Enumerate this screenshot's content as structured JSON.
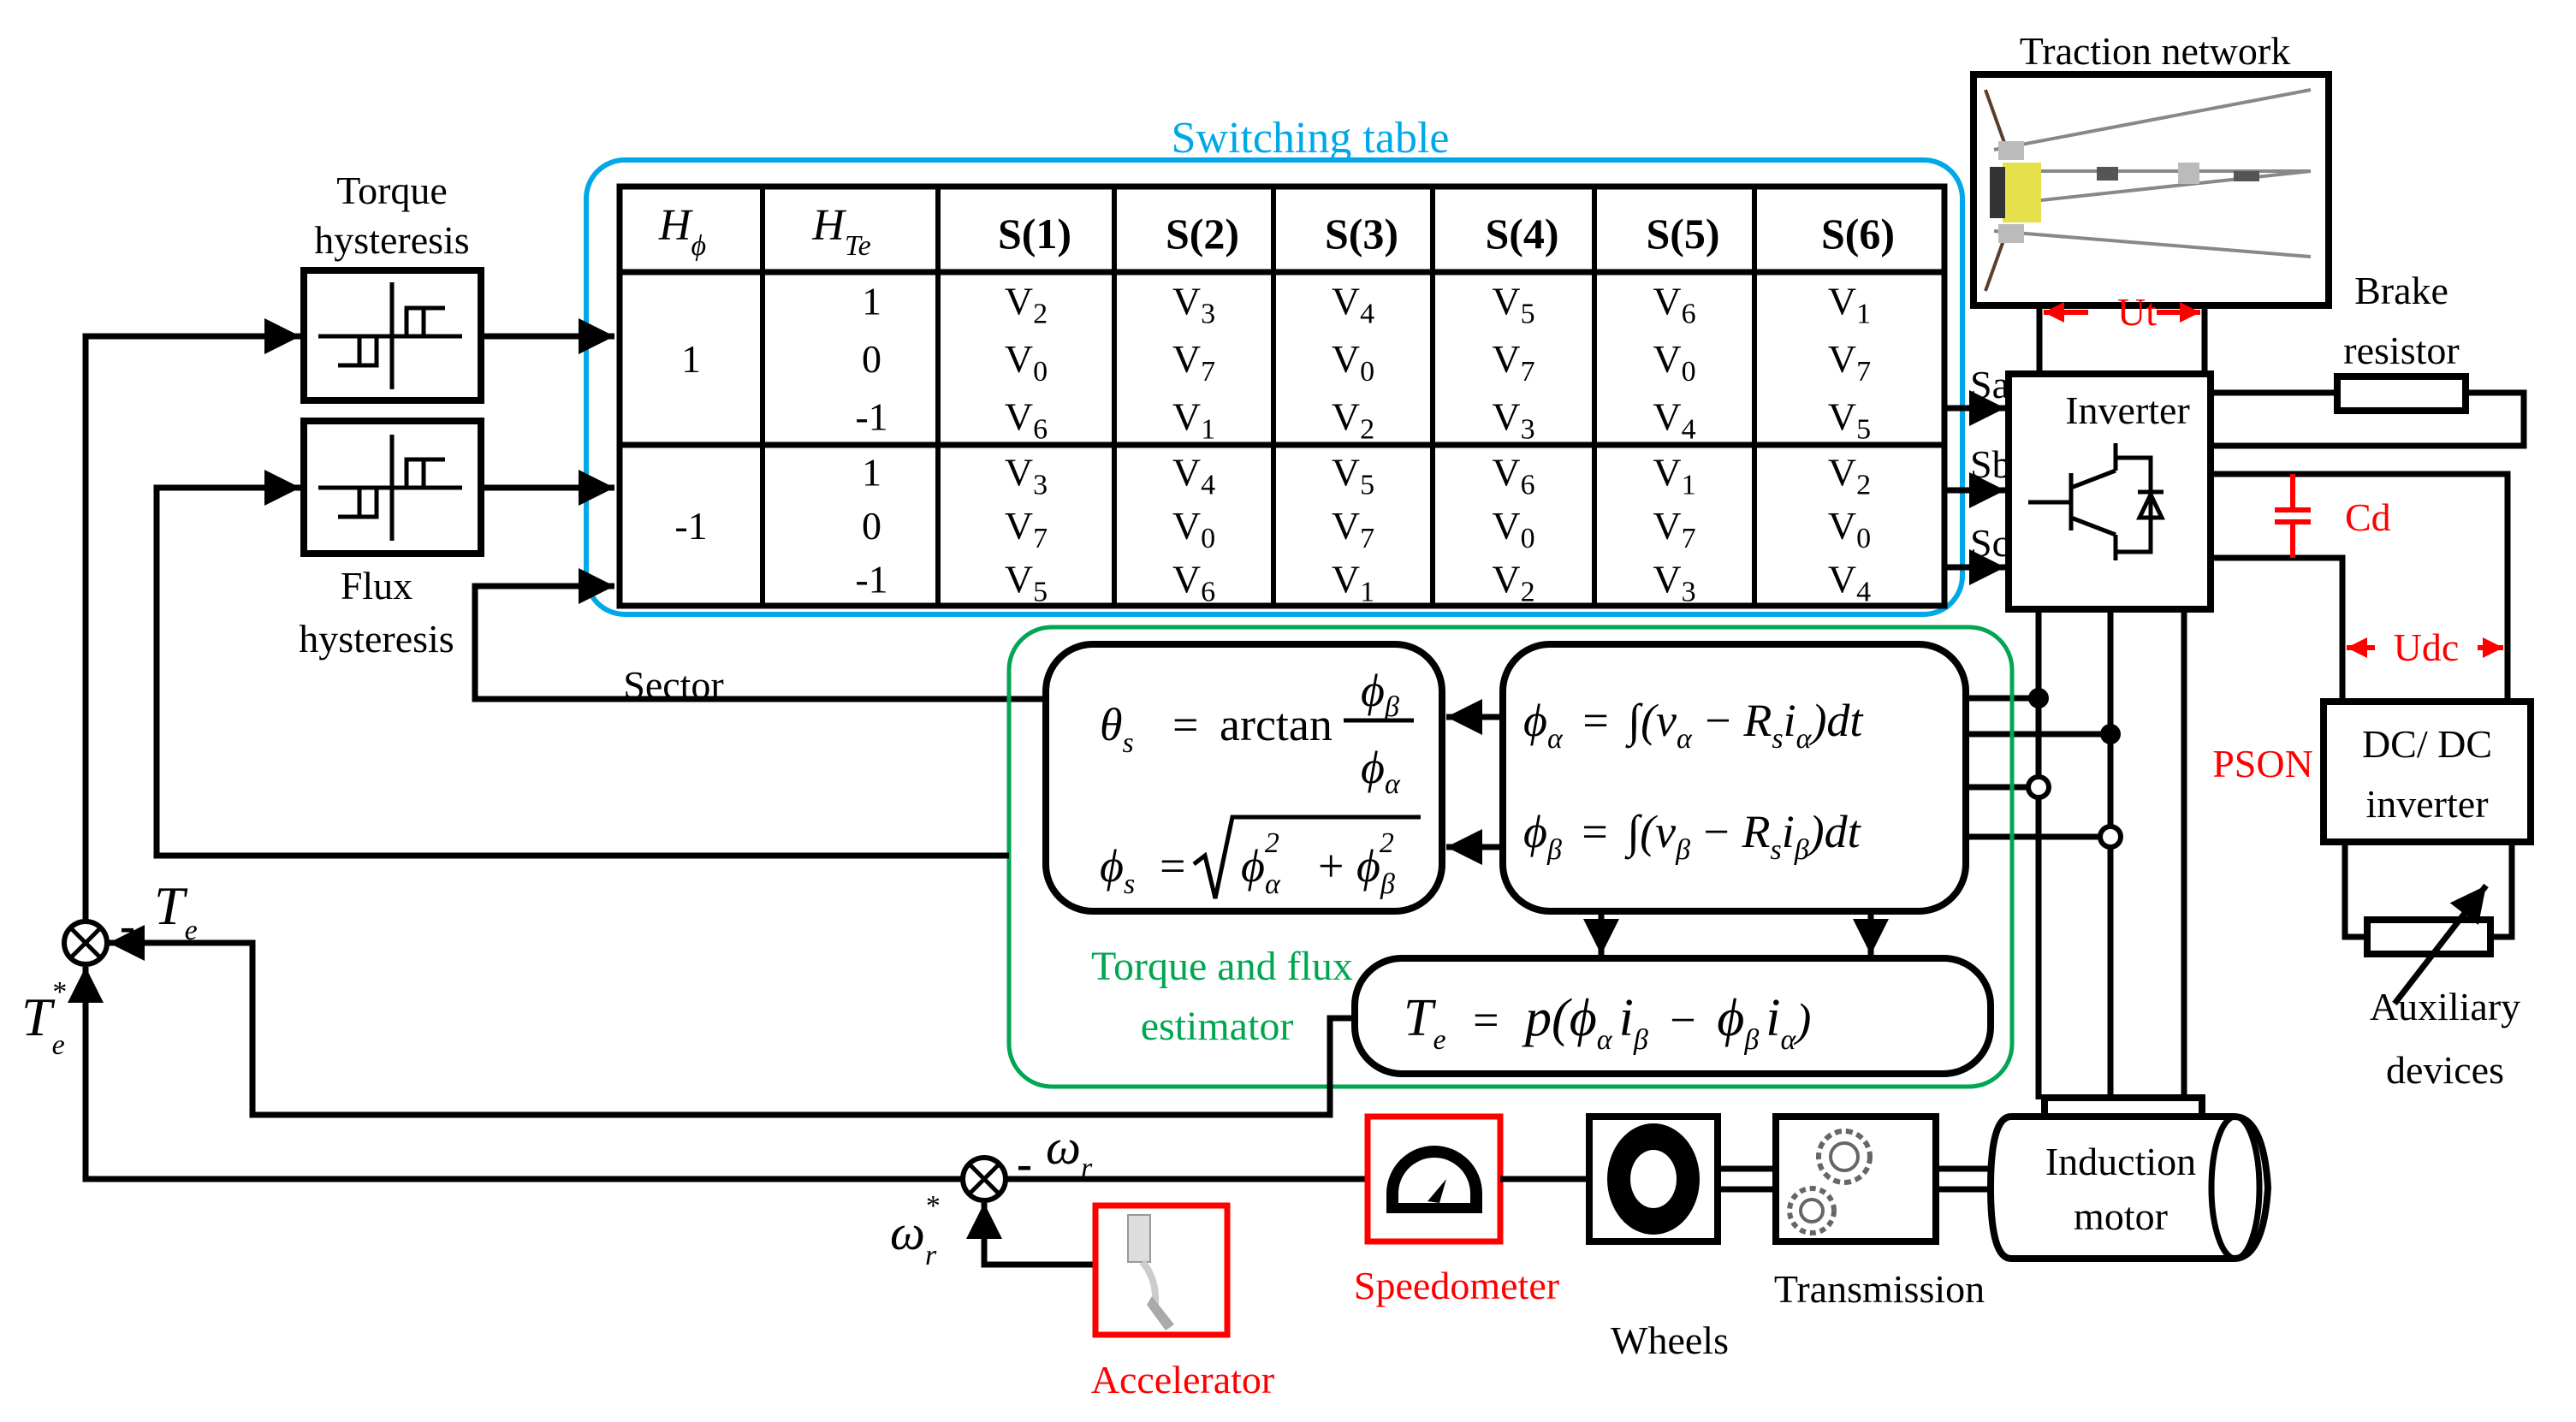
{
  "colors": {
    "switching_table_border": "#00a8e8",
    "estimator_border": "#00a651",
    "highlight_red": "#ff0000",
    "line": "#000000"
  },
  "hysteresis": {
    "torque_label_line1": "Torque",
    "torque_label_line2": "hysteresis",
    "flux_label_line1": "Flux",
    "flux_label_line2": "hysteresis"
  },
  "switching_table": {
    "title": "Switching table",
    "header": {
      "h_phi": "H",
      "h_phi_sub": "ϕ",
      "h_te": "H",
      "h_te_sub": "Te",
      "sectors": [
        "S(1)",
        "S(2)",
        "S(3)",
        "S(4)",
        "S(5)",
        "S(6)"
      ]
    },
    "blocks": [
      {
        "h_phi": "1",
        "rows": [
          {
            "h_te": "1",
            "vectors": [
              "2",
              "3",
              "4",
              "5",
              "6",
              "1"
            ]
          },
          {
            "h_te": "0",
            "vectors": [
              "0",
              "7",
              "0",
              "7",
              "0",
              "7"
            ]
          },
          {
            "h_te": "-1",
            "vectors": [
              "6",
              "1",
              "2",
              "3",
              "4",
              "5"
            ]
          }
        ]
      },
      {
        "h_phi": "-1",
        "rows": [
          {
            "h_te": "1",
            "vectors": [
              "3",
              "4",
              "5",
              "6",
              "1",
              "2"
            ]
          },
          {
            "h_te": "0",
            "vectors": [
              "7",
              "0",
              "7",
              "0",
              "7",
              "0"
            ]
          },
          {
            "h_te": "-1",
            "vectors": [
              "5",
              "6",
              "1",
              "2",
              "3",
              "4"
            ]
          }
        ]
      }
    ],
    "vector_prefix": "V",
    "outputs": [
      "Sa",
      "Sb",
      "Sc"
    ]
  },
  "sector_label": "Sector",
  "estimator": {
    "title_line1": "Torque and flux",
    "title_line2": "estimator",
    "theta_eq": {
      "lhs": "θ",
      "lhs_sub": "s",
      "eq": "=",
      "fn": "arctan",
      "num": "ϕ",
      "num_sub": "β",
      "den": "ϕ",
      "den_sub": "α"
    },
    "phi_s_eq": {
      "lhs": "ϕ",
      "lhs_sub": "s",
      "eq": "=",
      "a": "ϕ",
      "a_sub": "α",
      "a_sup": "2",
      "plus": "+",
      "b": "ϕ",
      "b_sub": "β",
      "b_sup": "2"
    },
    "phi_alpha_eq": {
      "lhs": "ϕ",
      "lhs_sub": "α",
      "eq": "=",
      "int": "∫",
      "open": "(",
      "v": "v",
      "v_sub": "α",
      "minus": "−",
      "r": "R",
      "r_sub": "s",
      "i": "i",
      "i_sub": "α",
      "close": ")",
      "dt": "dt"
    },
    "phi_beta_eq": {
      "lhs": "ϕ",
      "lhs_sub": "β",
      "eq": "=",
      "int": "∫",
      "open": "(",
      "v": "v",
      "v_sub": "β",
      "minus": "−",
      "r": "R",
      "r_sub": "s",
      "i": "i",
      "i_sub": "β",
      "close": ")",
      "dt": "dt"
    },
    "torque_eq": {
      "lhs": "T",
      "lhs_sub": "e",
      "eq": "=",
      "p": "p(",
      "a": "ϕ",
      "a_sub": "α",
      "ia": "i",
      "ia_sub": "β",
      "minus": "−",
      "b": "ϕ",
      "b_sub": "β",
      "ib": "i",
      "ib_sub": "α",
      "close": ")"
    }
  },
  "summing": {
    "torque_feedback": {
      "sym": "T",
      "sub": "e",
      "sign": "-"
    },
    "torque_ref": {
      "sym": "T",
      "sub": "e",
      "sup": "*"
    },
    "speed_feedback": {
      "sym": "ω",
      "sub": "r",
      "sign": "-"
    },
    "speed_ref": {
      "sym": "ω",
      "sub": "r",
      "sup": "*"
    }
  },
  "power": {
    "traction_network": "Traction network",
    "ut": "Ut",
    "inverter": "Inverter",
    "brake_line1": "Brake",
    "brake_line2": "resistor",
    "cd": "Cd",
    "udc": "Udc",
    "pson": "PSON",
    "dcdc_line1": "DC/ DC",
    "dcdc_line2": "inverter",
    "aux_line1": "Auxiliary",
    "aux_line2": "devices",
    "motor_line1": "Induction",
    "motor_line2": "motor"
  },
  "drivetrain": {
    "speedometer": "Speedometer",
    "wheels": "Wheels",
    "transmission": "Transmission",
    "accelerator": "Accelerator"
  }
}
